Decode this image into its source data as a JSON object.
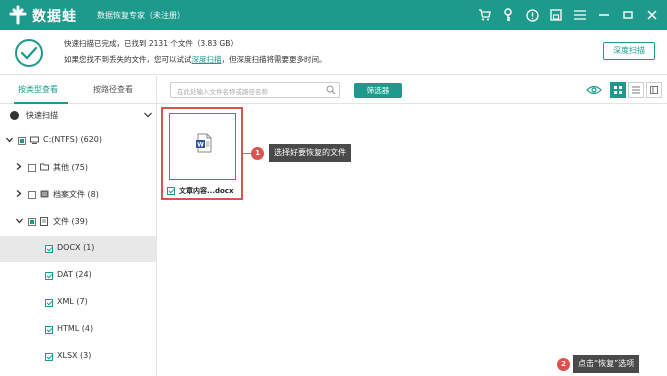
{
  "app": {
    "logo_text": "数据蛙",
    "subtitle": "数据恢复专家（未注册）",
    "accent": "#1e9a8c",
    "titlebar_icons": [
      "cart-icon",
      "key-icon",
      "help-icon",
      "save-icon",
      "menu-icon",
      "minimize-icon",
      "maximize-icon",
      "close-icon"
    ]
  },
  "status": {
    "line1": "快速扫描已完成，已找到 2131 个文件（3.83 GB）",
    "line2_prefix": "如果您找不到丢失的文件，您可以试试",
    "line2_link": "深度扫描",
    "line2_suffix": "，但深度扫描将需要更多时间。",
    "deep_scan_button": "深度扫描"
  },
  "tabs": {
    "by_type": "按类型查看",
    "by_path": "按路径查看"
  },
  "toolbar": {
    "search_placeholder": "在此处输入文件名称或路径名称",
    "filter_button": "筛选器"
  },
  "sidebar": {
    "quick_scan_label": "快速扫描",
    "tree": [
      {
        "label": "C:(NTFS) (620)",
        "arrow": "down",
        "check": "partial",
        "icon": "drive-icon"
      },
      {
        "label": "其他 (75)",
        "arrow": "right",
        "check": "none",
        "icon": "folder-icon"
      },
      {
        "label": "档案文件 (8)",
        "arrow": "right",
        "check": "none",
        "icon": "archive-icon"
      },
      {
        "label": "文件 (39)",
        "arrow": "down",
        "check": "partial",
        "icon": "document-icon"
      },
      {
        "label": "DOCX (1)",
        "arrow": "",
        "check": "checked",
        "icon": ""
      },
      {
        "label": "DAT (24)",
        "arrow": "",
        "check": "checked",
        "icon": ""
      },
      {
        "label": "XML (7)",
        "arrow": "",
        "check": "checked",
        "icon": ""
      },
      {
        "label": "HTML (4)",
        "arrow": "",
        "check": "checked",
        "icon": ""
      },
      {
        "label": "XLSX (3)",
        "arrow": "",
        "check": "checked",
        "icon": ""
      }
    ]
  },
  "file": {
    "name": "文章内容...docx"
  },
  "annotations": {
    "step1_number": "1",
    "step1_text": "选择好要恢复的文件",
    "step2_number": "2",
    "step2_text": "点击“恢复”选项"
  }
}
